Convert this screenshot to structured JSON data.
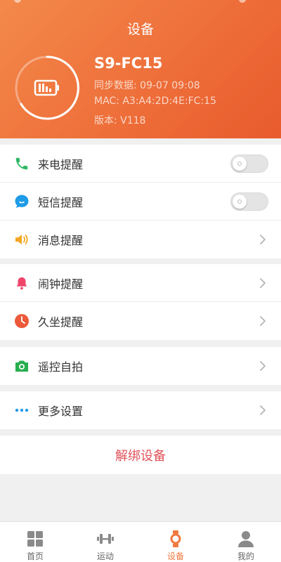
{
  "header": {
    "title": "设备",
    "device_name": "S9-FC15",
    "sync_text": "同步数据: 09-07 09:08",
    "mac_text": "MAC: A3:A4:2D:4E:FC:15",
    "version_text": "版本: V118"
  },
  "settings": {
    "call_reminder": {
      "label": "来电提醒",
      "enabled": false
    },
    "sms_reminder": {
      "label": "短信提醒",
      "enabled": false
    },
    "message_reminder": {
      "label": "消息提醒"
    },
    "alarm_reminder": {
      "label": "闹钟提醒"
    },
    "sedentary_reminder": {
      "label": "久坐提醒"
    },
    "remote_selfie": {
      "label": "遥控自拍"
    },
    "more_settings": {
      "label": "更多设置"
    }
  },
  "unbind_label": "解绑设备",
  "tabbar": {
    "tabs": [
      {
        "label": "首页",
        "icon": "home-grid-icon",
        "active": false
      },
      {
        "label": "运动",
        "icon": "dumbbell-icon",
        "active": false
      },
      {
        "label": "设备",
        "icon": "watch-icon",
        "active": true
      },
      {
        "label": "我的",
        "icon": "person-icon",
        "active": false
      }
    ]
  },
  "colors": {
    "header_start": "#f3894a",
    "header_end": "#e85b2c",
    "accent": "#ef7a3e",
    "unbind_red": "#e0525a"
  }
}
